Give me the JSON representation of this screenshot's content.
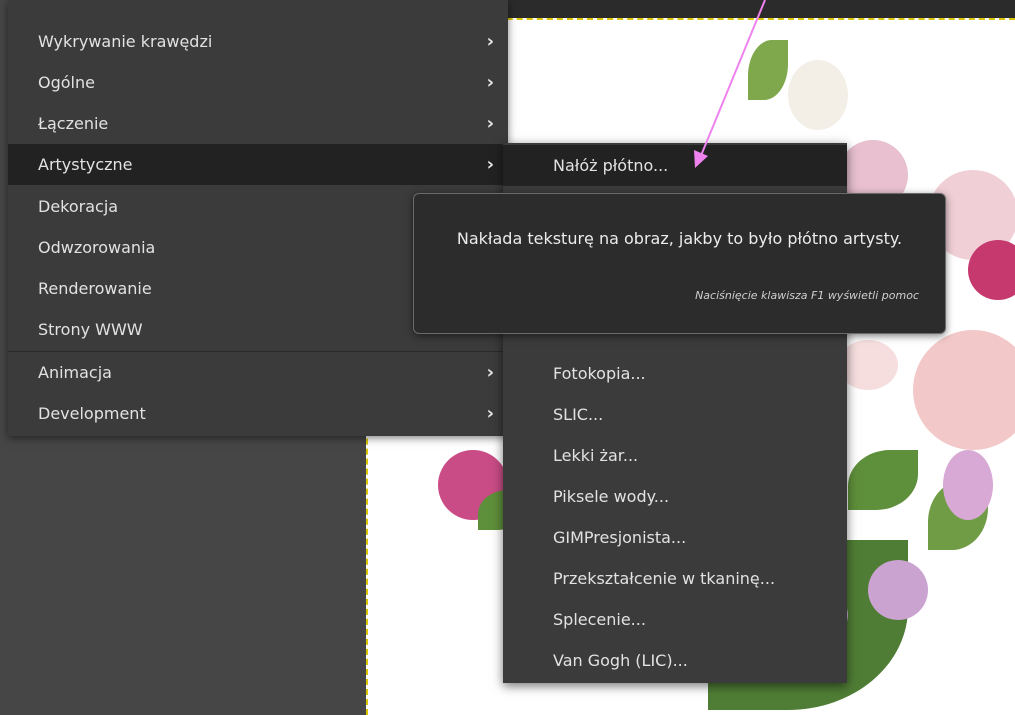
{
  "main_menu": {
    "items": [
      {
        "label": "Wykrywanie krawędzi",
        "has_submenu": true
      },
      {
        "label": "Ogólne",
        "has_submenu": true
      },
      {
        "label": "Łączenie",
        "has_submenu": true
      },
      {
        "label": "Artystyczne",
        "has_submenu": true,
        "active": true
      },
      {
        "label": "Dekoracja",
        "has_submenu": true
      },
      {
        "label": "Odwzorowania",
        "has_submenu": true
      },
      {
        "label": "Renderowanie",
        "has_submenu": true
      },
      {
        "label": "Strony WWW",
        "has_submenu": true
      },
      {
        "label": "Animacja",
        "has_submenu": true
      },
      {
        "label": "Development",
        "has_submenu": true
      }
    ],
    "chevron": "›"
  },
  "submenu": {
    "items": [
      {
        "label": "Nałóż płótno...",
        "active": true
      },
      {
        "label": "Fotokopia..."
      },
      {
        "label": "SLIC..."
      },
      {
        "label": "Lekki żar..."
      },
      {
        "label": "Piksele wody..."
      },
      {
        "label": "GIMPresjonista..."
      },
      {
        "label": "Przekształcenie w tkaninę..."
      },
      {
        "label": "Splecenie..."
      },
      {
        "label": "Van Gogh (LIC)..."
      }
    ]
  },
  "tooltip": {
    "text": "Nakłada teksturę na obraz, jakby to było płótno artysty.",
    "hint": "Naciśnięcie klawisza F1 wyświetli pomoc"
  },
  "colors": {
    "menu_bg": "#3b3b3b",
    "menu_active": "#222222",
    "annotation_arrow": "#ee82ee",
    "selection_border": "#d9c400"
  }
}
